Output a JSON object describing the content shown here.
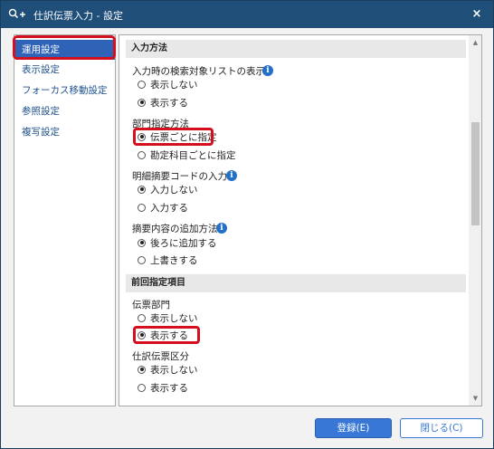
{
  "window": {
    "title": "仕訳伝票入力 - 設定",
    "app_icon": "search-plus-icon",
    "close_glyph": "×"
  },
  "nav": {
    "items": [
      {
        "label": "運用設定",
        "selected": true
      },
      {
        "label": "表示設定",
        "selected": false
      },
      {
        "label": "フォーカス移動設定",
        "selected": false
      },
      {
        "label": "参照設定",
        "selected": false
      },
      {
        "label": "複写設定",
        "selected": false
      }
    ]
  },
  "content": {
    "section1": {
      "header": "入力方法",
      "search_list": {
        "label": "入力時の検索対象リストの表示",
        "options": [
          "表示しない",
          "表示する"
        ],
        "selected": 1
      },
      "dept_method": {
        "label": "部門指定方法",
        "options": [
          "伝票ごとに指定",
          "勘定科目ごとに指定"
        ],
        "selected": 0
      },
      "summary_code": {
        "label": "明細摘要コードの入力",
        "options": [
          "入力しない",
          "入力する"
        ],
        "selected": 0
      },
      "summary_append": {
        "label": "摘要内容の追加方法",
        "options": [
          "後ろに追加する",
          "上書きする"
        ],
        "selected": 0
      }
    },
    "section2": {
      "header": "前回指定項目",
      "voucher_dept": {
        "label": "伝票部門",
        "options": [
          "表示しない",
          "表示する"
        ],
        "selected": 1
      },
      "voucher_type": {
        "label": "仕訳伝票区分",
        "options": [
          "表示しない",
          "表示する"
        ],
        "selected": 0
      }
    }
  },
  "buttons": {
    "register": "登録(E)",
    "close": "閉じる(C)"
  },
  "colors": {
    "titlebar": "#1f4e79",
    "nav_selected": "#2e63b8",
    "highlight": "#d4101f",
    "info": "#2470c8",
    "primary_button": "#3877d6"
  }
}
